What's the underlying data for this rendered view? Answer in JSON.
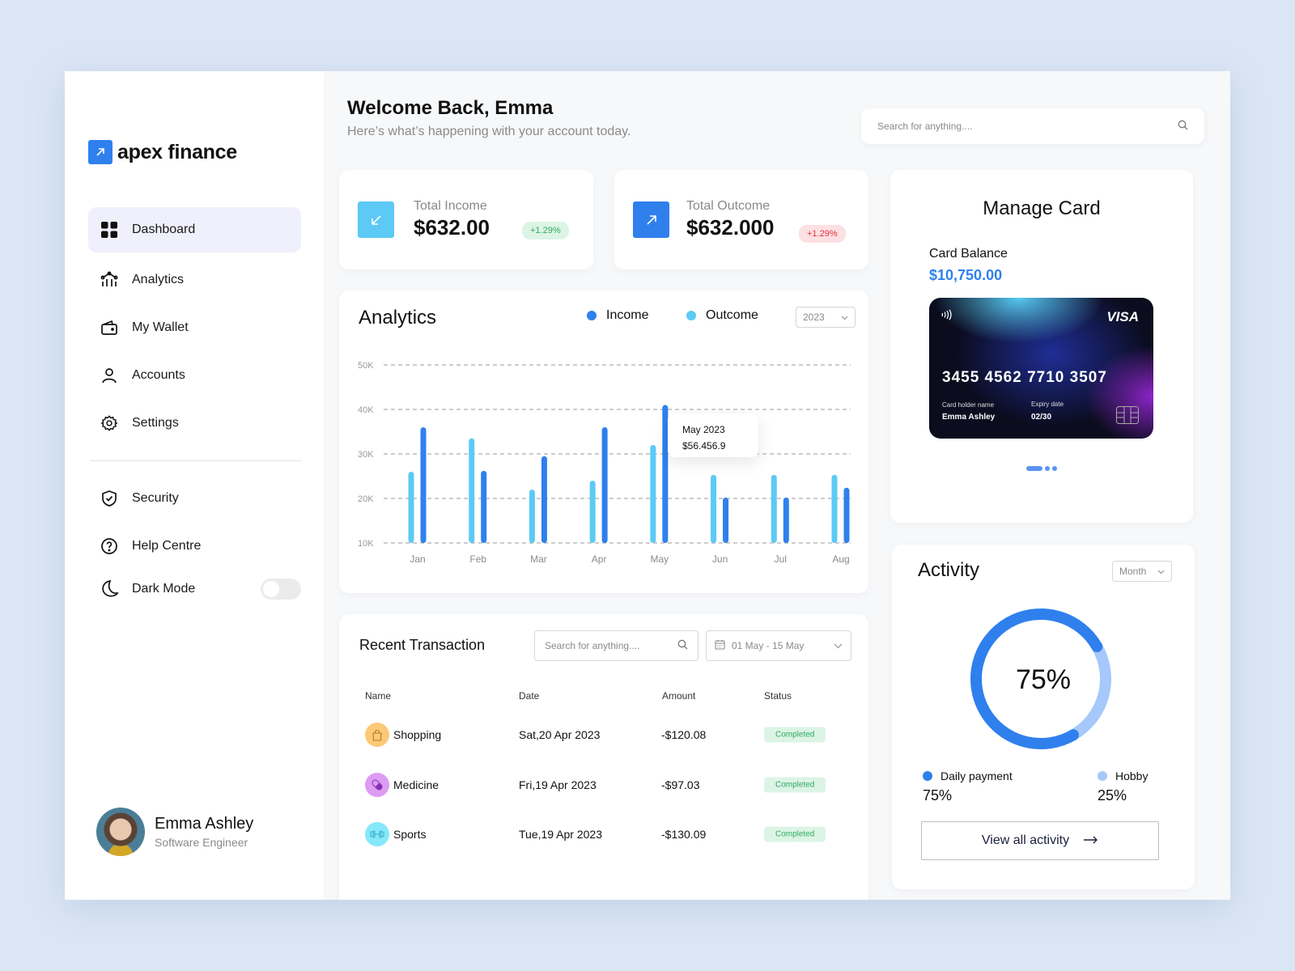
{
  "brand": {
    "name": "apex finance"
  },
  "sidebar": {
    "items": [
      {
        "label": "Dashboard",
        "icon": "grid-icon",
        "active": true
      },
      {
        "label": "Analytics",
        "icon": "analytics-icon"
      },
      {
        "label": "My Wallet",
        "icon": "wallet-icon"
      },
      {
        "label": "Accounts",
        "icon": "user-icon"
      },
      {
        "label": "Settings",
        "icon": "gear-icon"
      }
    ],
    "secondary": [
      {
        "label": "Security",
        "icon": "shield-icon"
      },
      {
        "label": "Help Centre",
        "icon": "help-icon"
      },
      {
        "label": "Dark Mode",
        "icon": "moon-icon",
        "toggle": false
      }
    ],
    "profile": {
      "name": "Emma Ashley",
      "role": "Software Engineer"
    }
  },
  "header": {
    "title": "Welcome Back, Emma",
    "subtitle": "Here’s what’s happening with your account today.",
    "search_placeholder": "Search for anything...."
  },
  "stats": [
    {
      "label": "Total Income",
      "value": "$632.00",
      "change": "+1.29%",
      "tone": "green",
      "color": "#5ccaf5"
    },
    {
      "label": "Total Outcome",
      "value": "$632.000",
      "change": "+1.29%",
      "tone": "red",
      "color": "#2f80ed"
    }
  ],
  "analytics": {
    "title": "Analytics",
    "year": "2023",
    "tooltip": {
      "title": "May 2023",
      "value": "$56.456.9"
    }
  },
  "chart_data": {
    "type": "bar",
    "title": "Analytics",
    "categories": [
      "Jan",
      "Feb",
      "Mar",
      "Apr",
      "May",
      "Jun",
      "Jul",
      "Aug"
    ],
    "series": [
      {
        "name": "Income",
        "color": "#2f80ed",
        "values": [
          36000,
          26200,
          29500,
          36000,
          41000,
          20200,
          20200,
          22400
        ]
      },
      {
        "name": "Outcome",
        "color": "#5ccaf5",
        "values": [
          26000,
          33500,
          22000,
          24000,
          32000,
          25300,
          25300,
          25300
        ]
      }
    ],
    "yticks": [
      "10K",
      "20K",
      "30K",
      "40K",
      "50K"
    ],
    "ylim": [
      10000,
      50000
    ],
    "grid": true,
    "legend": "top-right",
    "xlabel": "",
    "ylabel": ""
  },
  "transactions": {
    "title": "Recent Transaction",
    "search_placeholder": "Search for anything....",
    "date_range": "01 May - 15 May",
    "columns": [
      "Name",
      "Date",
      "Amount",
      "Status"
    ],
    "rows": [
      {
        "name": "Shopping",
        "date": "Sat,20 Apr 2023",
        "amount": "-$120.08",
        "status": "Completed",
        "icon": "shopping-bag-icon",
        "bg": "#fcc978",
        "fg": "#c98a20"
      },
      {
        "name": "Medicine",
        "date": "Fri,19 Apr 2023",
        "amount": "-$97.03",
        "status": "Completed",
        "icon": "pill-icon",
        "bg": "#dc9cf2",
        "fg": "#8a2fb8"
      },
      {
        "name": "Sports",
        "date": "Tue,19 Apr 2023",
        "amount": "-$130.09",
        "status": "Completed",
        "icon": "dumbbell-icon",
        "bg": "#86e8fa",
        "fg": "#3ab0c9"
      }
    ]
  },
  "manage_card": {
    "title": "Manage Card",
    "balance_label": "Card Balance",
    "balance": "$10,750.00",
    "card": {
      "brand": "VISA",
      "number": "3455 4562 7710 3507",
      "holder_label": "Card holder name",
      "holder": "Emma Ashley",
      "expiry_label": "Expiry date",
      "expiry": "02/30"
    },
    "pages": 3,
    "current_page": 1
  },
  "activity": {
    "title": "Activity",
    "period": "Month",
    "percent_label": "75%",
    "segments": [
      {
        "name": "Daily payment",
        "value": 75,
        "label": "75%",
        "color": "#2f80ed"
      },
      {
        "name": "Hobby",
        "value": 25,
        "label": "25%",
        "color": "#a6c8fb"
      }
    ],
    "button": "View all activity"
  }
}
